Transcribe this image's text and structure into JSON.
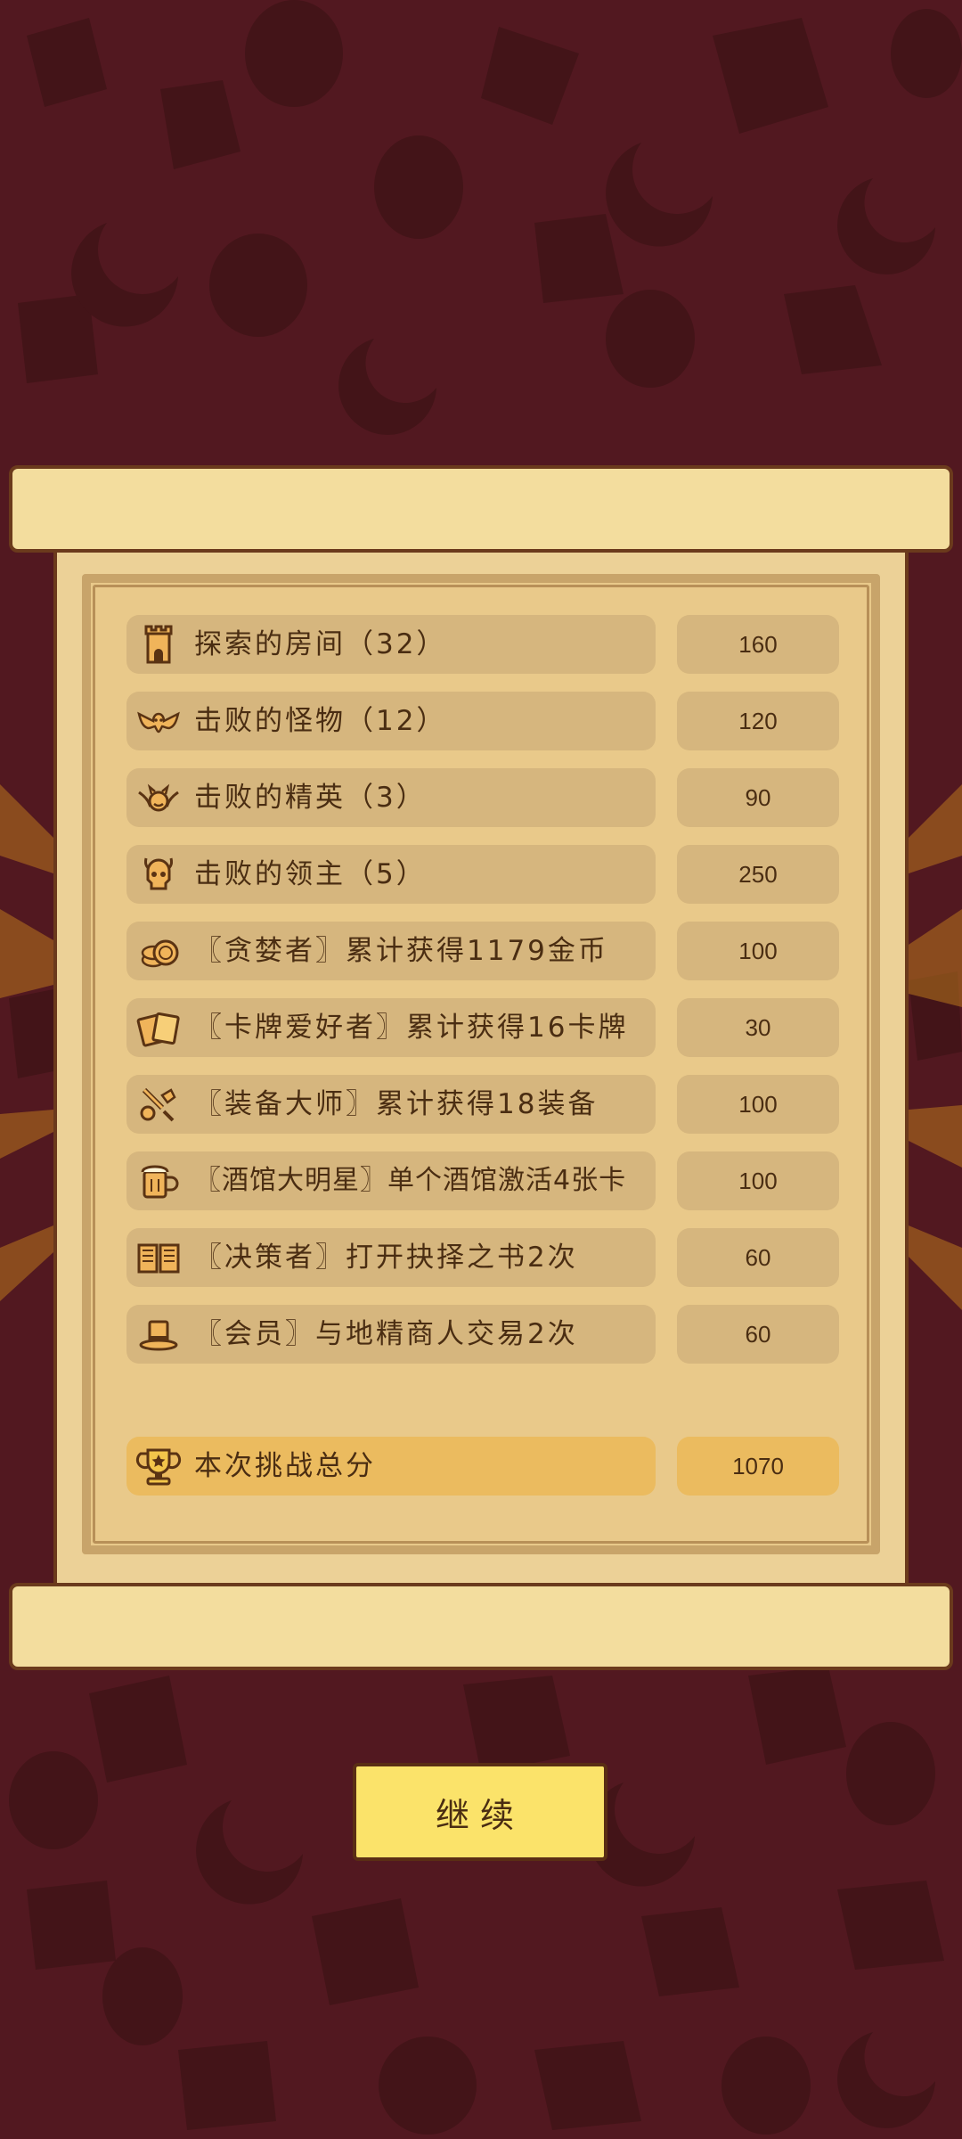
{
  "rows": [
    {
      "label": "探索的房间（32）",
      "value": "160",
      "icon": "tower-icon"
    },
    {
      "label": "击败的怪物（12）",
      "value": "120",
      "icon": "bat-icon"
    },
    {
      "label": "击败的精英（3）",
      "value": "90",
      "icon": "winged-demon-icon"
    },
    {
      "label": "击败的领主（5）",
      "value": "250",
      "icon": "horned-skull-icon"
    },
    {
      "label": "〖贪婪者〗累计获得1179金币",
      "value": "100",
      "icon": "coin-stack-icon"
    },
    {
      "label": "〖卡牌爱好者〗累计获得16卡牌",
      "value": "30",
      "icon": "cards-icon"
    },
    {
      "label": "〖装备大师〗累计获得18装备",
      "value": "100",
      "icon": "equipment-icon"
    },
    {
      "label": "〖酒馆大明星〗单个酒馆激活4张卡",
      "value": "100",
      "icon": "beer-mug-icon"
    },
    {
      "label": "〖决策者〗打开抉择之书2次",
      "value": "60",
      "icon": "book-icon"
    },
    {
      "label": "〖会员〗与地精商人交易2次",
      "value": "60",
      "icon": "top-hat-icon"
    }
  ],
  "total": {
    "label": "本次挑战总分",
    "value": "1070",
    "icon": "trophy-icon"
  },
  "continue_label": "继续",
  "colors": {
    "background": "#521820",
    "pattern": "#431418",
    "paper": "#ecd197",
    "pill": "#d6b67e",
    "total_pill": "#ebbb5f",
    "button": "#fbe36a",
    "text": "#4a2d12"
  }
}
